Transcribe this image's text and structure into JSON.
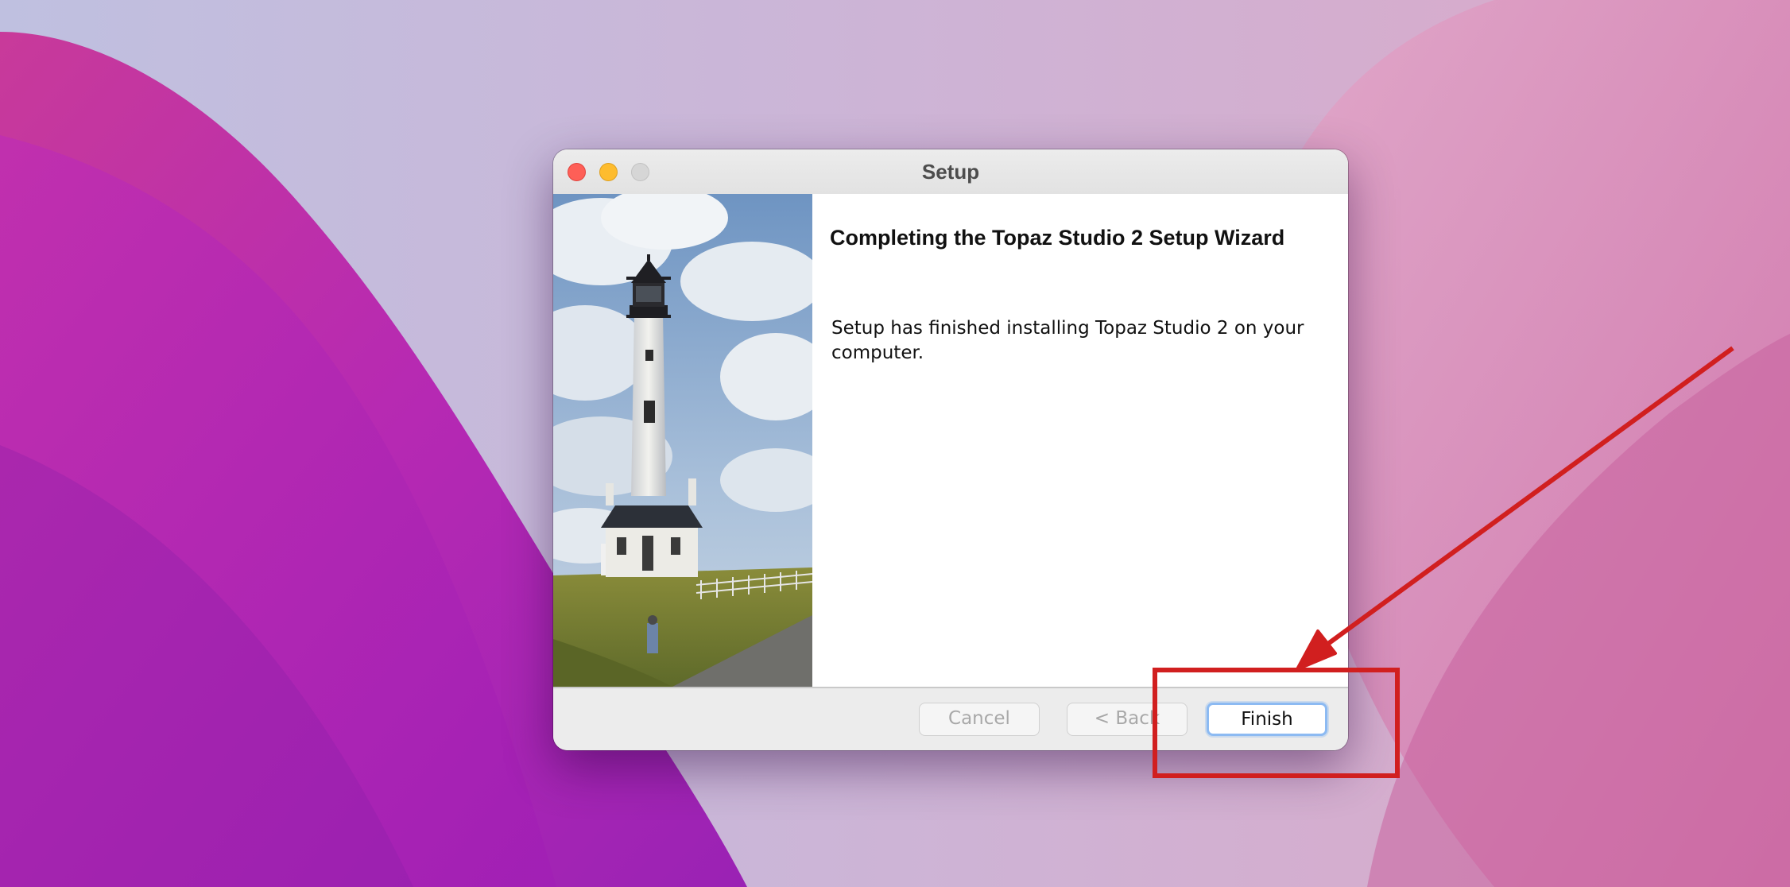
{
  "window": {
    "title": "Setup"
  },
  "wizard": {
    "heading": "Completing the Topaz Studio 2 Setup Wizard",
    "message": "Setup has finished installing Topaz Studio 2 on your computer."
  },
  "buttons": {
    "cancel": "Cancel",
    "back": "< Back",
    "finish": "Finish"
  },
  "colors": {
    "annotation": "#d11f1f",
    "close": "#fe5f57",
    "minimize": "#febc2e",
    "zoom_disabled": "#d6d6d6",
    "focus_ring": "#8cbaf2"
  },
  "icons": {
    "close": "close-icon",
    "minimize": "minimize-icon",
    "zoom": "zoom-icon",
    "arrow": "arrow-icon"
  }
}
